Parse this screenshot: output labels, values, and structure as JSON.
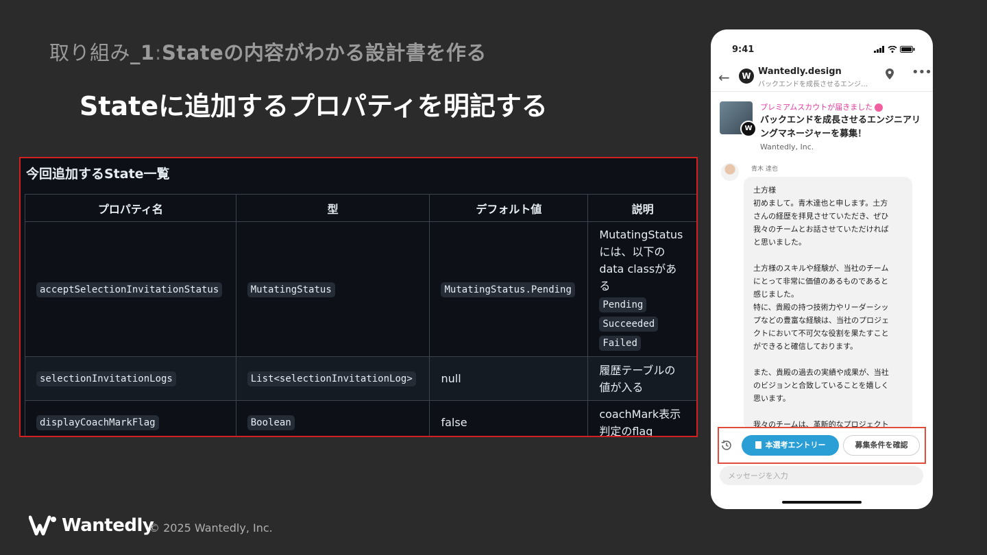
{
  "slide": {
    "breadcrumb_prefix": "取り組み",
    "breadcrumb_number": "_1",
    "breadcrumb_sep": ":",
    "breadcrumb_rest": "Stateの内容がわかる設計書を作る",
    "title": "Stateに追加するプロパティを明記する"
  },
  "doc": {
    "heading": "今回追加するState一覧",
    "columns": [
      "プロパティ名",
      "型",
      "デフォルト値",
      "説明"
    ],
    "rows": [
      {
        "property": "acceptSelectionInvitationStatus",
        "type": "MutatingStatus",
        "default": "MutatingStatus.Pending",
        "description": "MutatingStatusには、以下のdata classがある",
        "codes": [
          "Pending",
          "Succeeded",
          "Failed"
        ]
      },
      {
        "property": "selectionInvitationLogs",
        "type": "List<selectionInvitationLog>",
        "default": "null",
        "description": "履歴テーブルの値が入る"
      },
      {
        "property": "displayCoachMarkFlag",
        "type": "Boolean",
        "default": "false",
        "description": "coachMark表示判定のflag"
      }
    ]
  },
  "footer": {
    "wordmark": "Wantedly",
    "copyright": "© 2025 Wantedly, Inc."
  },
  "phone": {
    "time": "9:41",
    "header_name": "Wantedly.design",
    "header_sub": "バックエンドを成長させるエンジ…",
    "header_avatar": "W",
    "scout_label": "プレミアムスカウトが届きました",
    "scout_title": "バックエンドを成長させるエンジニアリングマネージャーを募集！",
    "scout_company": "Wantedly, Inc.",
    "sender_name": "青木 達也",
    "message": [
      "土方様\n初めまして。青木達也と申します。土方\nさんの経歴を拝見させていただき、ぜひ\n我々のチームとお話させていただければ\nと思いました。",
      "土方様のスキルや経験が、当社のチーム\nにとって非常に価値のあるものであると\n感じました。\n特に、貴殿の持つ技術力やリーダーシッ\nプなどの豊富な経験は、当社のプロジェ\nクトにおいて不可欠な役割を果たすこと\nができると確信しております。",
      "また、貴殿の過去の実績や成果が、当社\nのビジョンと合致していることを嬉しく\n思います。",
      "我々のチームは、革新的なプロジェクト"
    ],
    "entry_button": "本選考エントリー",
    "conditions_button": "募集条件を確認",
    "input_placeholder": "メッセージを入力"
  },
  "colors": {
    "highlight_border": "#d0201f",
    "entry_button": "#2a9fd6",
    "scout_pink": "#e23c9c"
  }
}
